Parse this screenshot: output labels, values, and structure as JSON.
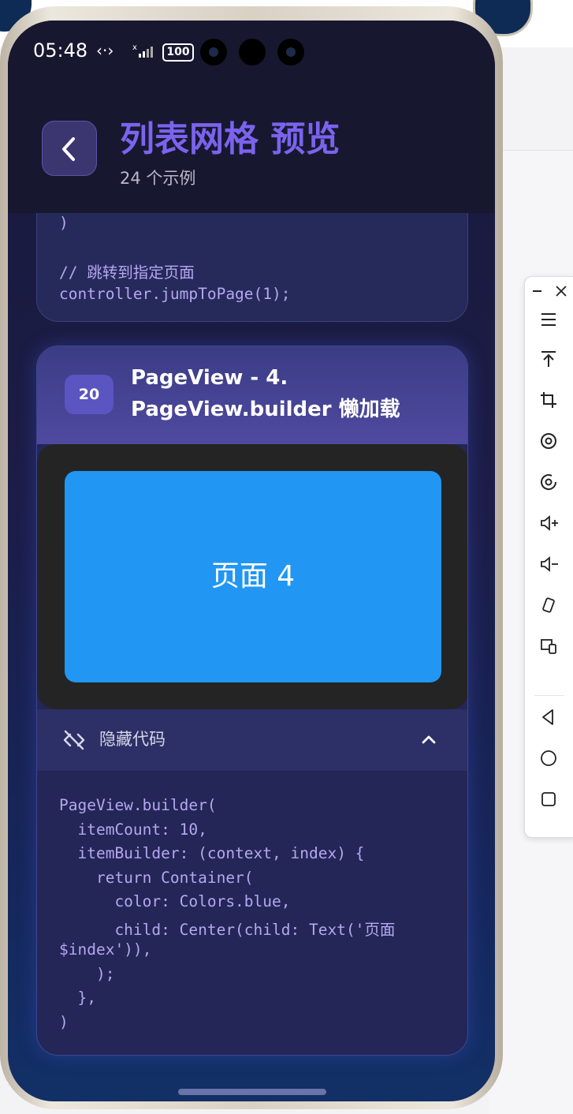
{
  "status_bar": {
    "time": "05:48",
    "battery": "100"
  },
  "app_bar": {
    "title": "列表网格 预览",
    "subtitle": "24 个示例"
  },
  "previous_card": {
    "code_tail": [
      ")",
      "// 跳转到指定页面",
      "controller.jumpToPage(1);"
    ]
  },
  "card": {
    "index": "20",
    "title": "PageView - 4. PageView.builder 懒加载",
    "preview_page_label": "页面 4",
    "toggle_label": "隐藏代码",
    "code_lines": [
      "PageView.builder(",
      "  itemCount: 10,",
      "  itemBuilder: (context, index) {",
      "    return Container(",
      "      color: Colors.blue,",
      "      child: Center(child: Text('页面",
      "$index')),",
      "    );",
      "  },",
      ")"
    ]
  },
  "colors": {
    "accent": "#7b63ee",
    "page_blue": "#2196f3",
    "code_text": "#b7a6f2"
  },
  "emulator_toolbar": {
    "items": [
      "minimize-icon",
      "close-icon",
      "menu-icon",
      "pin-top-icon",
      "crop-icon",
      "rotate-left-icon",
      "rotate-right-icon",
      "volume-up-icon",
      "volume-down-icon",
      "shake-icon",
      "screenshot-icon",
      "back-icon",
      "home-icon",
      "recents-icon"
    ]
  }
}
